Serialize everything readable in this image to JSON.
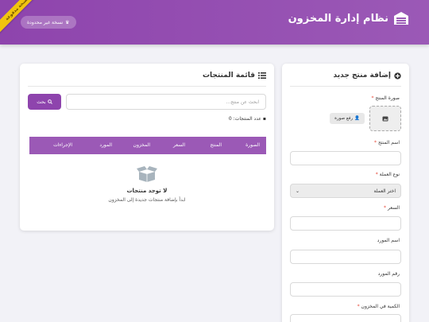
{
  "header": {
    "title": "نظام إدارة المخزون",
    "plan_badge": "نسخة غير محدودة",
    "ribbon": "نسخة مدفوعة"
  },
  "form": {
    "title": "إضافة منتج جديد",
    "image_label": "صورة المنتج",
    "upload_button": "رفع صورة",
    "name_label": "اسم المنتج",
    "currency_label": "نوع العملة",
    "currency_selected": "اختر العملة",
    "price_label": "السعر",
    "supplier_label": "اسم المورد",
    "supplier_number_label": "رقم المورد",
    "quantity_label": "الكمية في المخزون",
    "required_mark": "*"
  },
  "list": {
    "title": "قائمة المنتجات",
    "search_placeholder": "ابحث عن منتج...",
    "search_button": "بحث",
    "count_text": "عدد المنتجات: 0",
    "columns": [
      "الصورة",
      "المنتج",
      "السعر",
      "المخزون",
      "المورد",
      "الإجراءات"
    ],
    "empty_title": "لا توجد منتجات",
    "empty_subtitle": "ابدأ بإضافة منتجات جديدة إلى المخزون"
  },
  "colors": {
    "brand": "#8e44ad",
    "table_header": "#9b59b6",
    "ribbon": "#f1c40f",
    "required": "#e74c3c"
  },
  "icons": [
    "warehouse-icon",
    "crown-icon",
    "plus-circle-icon",
    "list-icon",
    "image-icon",
    "user-upload-icon",
    "search-icon",
    "box-icon",
    "empty-box-icon",
    "chevron-down-icon"
  ]
}
